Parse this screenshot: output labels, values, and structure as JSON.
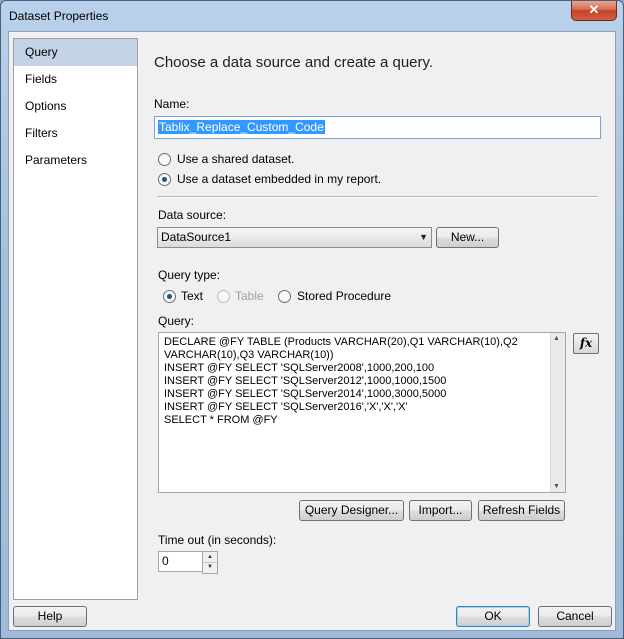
{
  "window": {
    "title": "Dataset Properties",
    "close_glyph": "✕"
  },
  "nav": {
    "items": [
      {
        "label": "Query",
        "selected": true
      },
      {
        "label": "Fields",
        "selected": false
      },
      {
        "label": "Options",
        "selected": false
      },
      {
        "label": "Filters",
        "selected": false
      },
      {
        "label": "Parameters",
        "selected": false
      }
    ]
  },
  "main": {
    "heading": "Choose a data source and create a query.",
    "name_label": "Name:",
    "name_value": "Tablix_Replace_Custom_Code",
    "radio_shared": "Use a shared dataset.",
    "radio_embedded": "Use a dataset embedded in my report.",
    "data_source_label": "Data source:",
    "data_source_value": "DataSource1",
    "new_button": "New...",
    "query_type_label": "Query type:",
    "query_type_text": "Text",
    "query_type_table": "Table",
    "query_type_sp": "Stored Procedure",
    "query_label": "Query:",
    "query_lines": [
      "DECLARE @FY TABLE (Products VARCHAR(20),Q1 VARCHAR(10),Q2",
      "VARCHAR(10),Q3 VARCHAR(10))",
      "INSERT @FY SELECT 'SQLServer2008',1000,200,100",
      "INSERT @FY SELECT 'SQLServer2012',1000,1000,1500",
      "INSERT @FY SELECT 'SQLServer2014',1000,3000,5000",
      "INSERT @FY SELECT 'SQLServer2016','X','X','X'",
      "SELECT * FROM @FY"
    ],
    "fx_label": "fx",
    "query_designer_button": "Query Designer...",
    "import_button": "Import...",
    "refresh_button": "Refresh Fields",
    "timeout_label": "Time out (in seconds):",
    "timeout_value": "0"
  },
  "footer": {
    "help": "Help",
    "ok": "OK",
    "cancel": "Cancel"
  },
  "colors": {
    "accent": "#3399ff",
    "nav_selected": "#c4d3e6",
    "close": "#c2442a"
  }
}
